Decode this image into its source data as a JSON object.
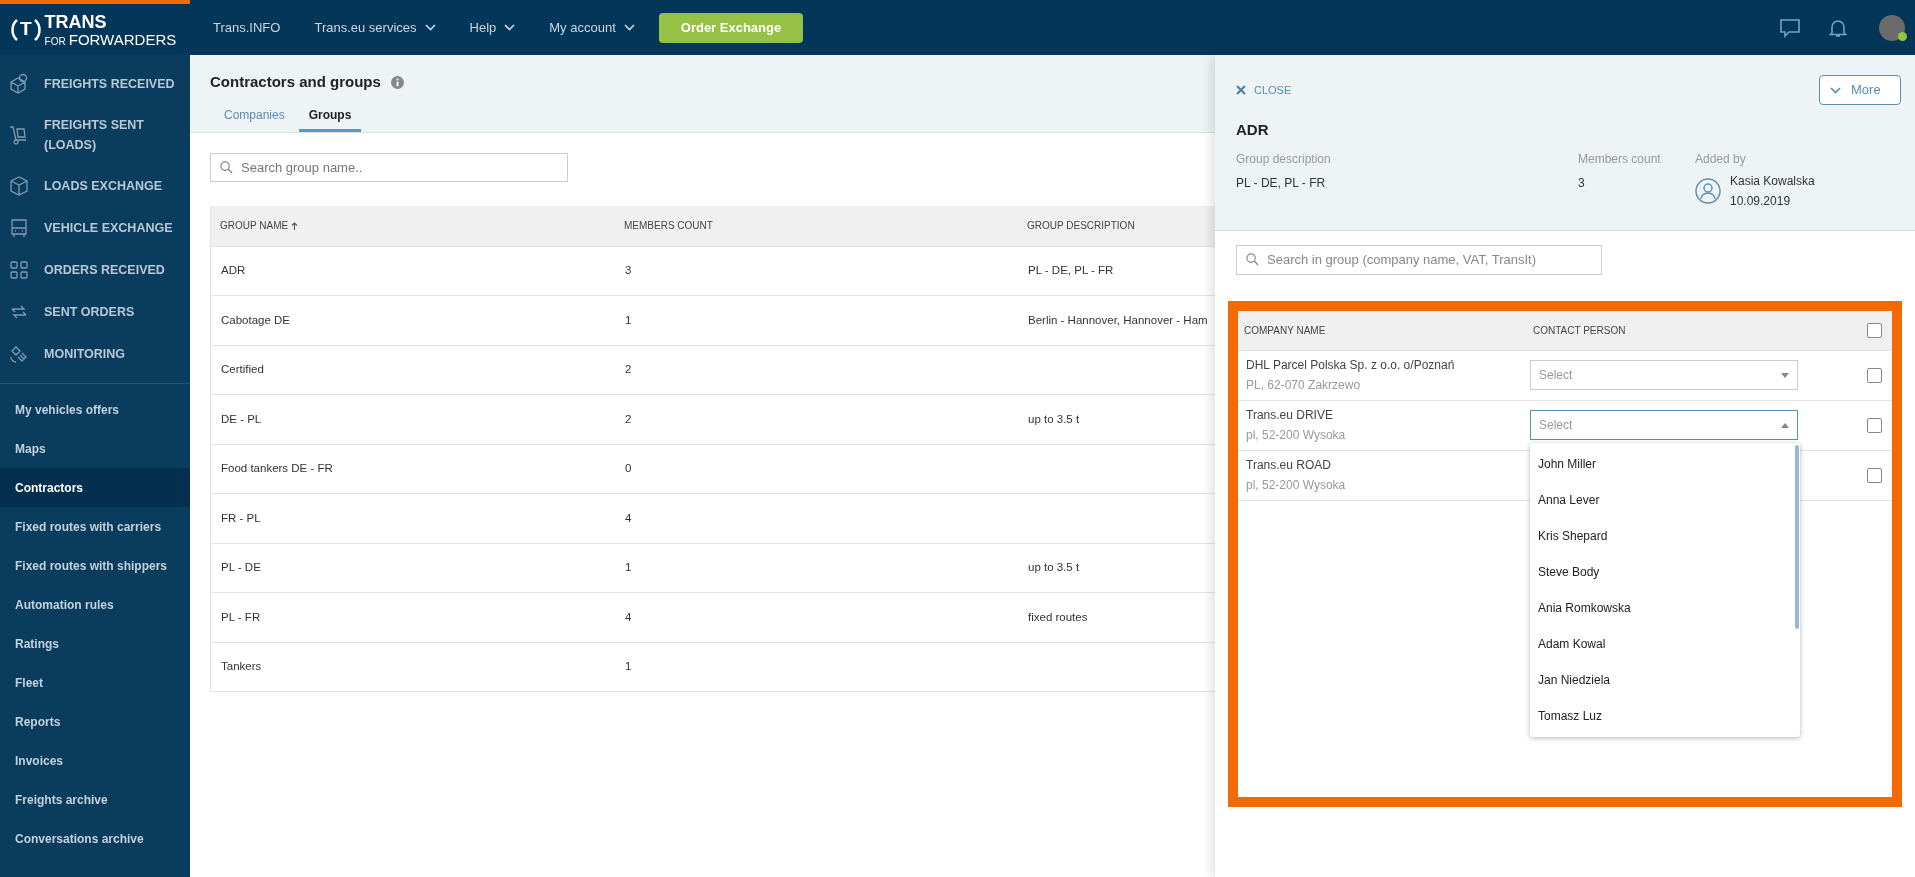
{
  "logo": {
    "mark": "T",
    "name": "TRANS",
    "small": "FOR",
    "tagline": "FORWARDERS"
  },
  "top_nav": [
    {
      "label": "Trans.INFO",
      "dropdown": false
    },
    {
      "label": "Trans.eu services",
      "dropdown": true
    },
    {
      "label": "Help",
      "dropdown": true
    },
    {
      "label": "My account",
      "dropdown": true
    }
  ],
  "order_button": "Order Exchange",
  "user": {
    "online": true
  },
  "sidebar": {
    "main_items": [
      {
        "label": "FREIGHTS RECEIVED"
      },
      {
        "label": "FREIGHTS SENT (LOADS)"
      },
      {
        "label": "LOADS EXCHANGE"
      },
      {
        "label": "VEHICLE EXCHANGE"
      },
      {
        "label": "ORDERS RECEIVED"
      },
      {
        "label": "SENT ORDERS"
      },
      {
        "label": "MONITORING"
      }
    ],
    "items": [
      {
        "label": "My vehicles offers",
        "selected": false
      },
      {
        "label": "Maps",
        "selected": false
      },
      {
        "label": "Contractors",
        "selected": true
      },
      {
        "label": "Fixed routes with carriers",
        "selected": false
      },
      {
        "label": "Fixed routes with shippers",
        "selected": false
      },
      {
        "label": "Automation rules",
        "selected": false
      },
      {
        "label": "Ratings",
        "selected": false
      },
      {
        "label": "Fleet",
        "selected": false
      },
      {
        "label": "Reports",
        "selected": false
      },
      {
        "label": "Invoices",
        "selected": false
      },
      {
        "label": "Freights archive",
        "selected": false
      },
      {
        "label": "Conversations archive",
        "selected": false
      }
    ]
  },
  "page": {
    "title": "Contractors and groups",
    "tabs": [
      {
        "label": "Companies",
        "selected": false
      },
      {
        "label": "Groups",
        "selected": true
      }
    ],
    "search": {
      "placeholder": "Search group name.."
    },
    "table": {
      "columns": [
        {
          "label": "GROUP NAME",
          "sorted": true
        },
        {
          "label": "MEMBERS COUNT",
          "sorted": false
        },
        {
          "label": "GROUP DESCRIPTION",
          "sorted": false
        }
      ],
      "rows": [
        [
          "ADR",
          "3",
          "PL - DE, PL - FR"
        ],
        [
          "Cabotage DE",
          "1",
          "Berlin - Hannover, Hannover - Ham"
        ],
        [
          "Certified",
          "2",
          ""
        ],
        [
          "DE - PL",
          "2",
          "up to 3.5 t"
        ],
        [
          "Food tankers DE - FR",
          "0",
          ""
        ],
        [
          "FR - PL",
          "4",
          ""
        ],
        [
          "PL - DE",
          "1",
          "up to 3.5 t"
        ],
        [
          "PL - FR",
          "4",
          "fixed routes"
        ],
        [
          "Tankers",
          "1",
          ""
        ]
      ]
    }
  },
  "panel": {
    "close": "CLOSE",
    "more": "More",
    "title": "ADR",
    "fields": [
      {
        "label": "Group description",
        "value": "PL - DE, PL - FR"
      },
      {
        "label": "Members count",
        "value": "3"
      }
    ],
    "added_by": {
      "label": "Added by",
      "name": "Kasia Kowalska",
      "date": "10.09.2019"
    },
    "search": {
      "placeholder": "Search in group (company name, VAT, TransIt)"
    },
    "members": {
      "columns": [
        "COMPANY NAME",
        "CONTACT PERSON"
      ],
      "all_checked": false,
      "rows": [
        {
          "name": "DHL Parcel Polska Sp. z o.o. o/Poznań",
          "address": "PL, 62-070 Zakrzewo",
          "contact": {
            "placeholder": "Select",
            "expanded": false
          },
          "checked": false
        },
        {
          "name": "Trans.eu DRIVE",
          "address": "pl, 52-200 Wysoka",
          "contact": {
            "placeholder": "Select",
            "expanded": true,
            "options": [
              "John Miller",
              "Anna Lever",
              "Kris Shepard",
              "Steve Body",
              "Ania Romkowska",
              "Adam Kowal",
              "Jan Niedziela",
              "Tomasz Luz"
            ]
          },
          "checked": false
        },
        {
          "name": "Trans.eu ROAD",
          "address": "pl, 52-200 Wysoka",
          "checked": false
        }
      ]
    }
  }
}
